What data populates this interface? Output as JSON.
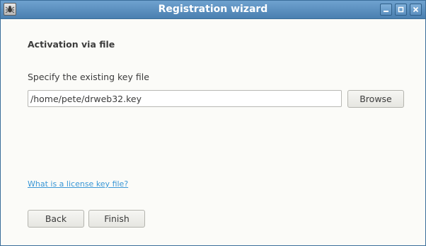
{
  "window": {
    "title": "Registration wizard",
    "app_icon": "drweb-spider-icon",
    "controls": [
      "minimize-icon",
      "maximize-icon",
      "close-icon"
    ]
  },
  "page": {
    "heading": "Activation via file",
    "field_label": "Specify the existing key file",
    "key_path_value": "/home/pete/drweb32.key",
    "browse_label": "Browse",
    "help_link": "What is a license key file?",
    "back_label": "Back",
    "finish_label": "Finish"
  },
  "colors": {
    "titlebar": "#4a7fb0",
    "link": "#3a97d6",
    "background": "#fbfbf8"
  }
}
